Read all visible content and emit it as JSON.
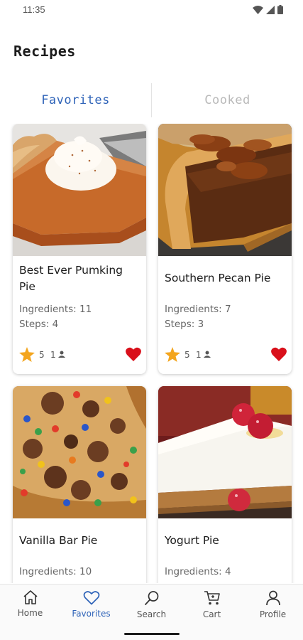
{
  "status_bar": {
    "time": "11:35",
    "icons": [
      "wifi-icon",
      "signal-icon",
      "battery-icon"
    ]
  },
  "page": {
    "title": "Recipes"
  },
  "tabs": [
    {
      "label": "Favorites",
      "active": true
    },
    {
      "label": "Cooked",
      "active": false
    }
  ],
  "recipes": [
    {
      "title": "Best Ever Pumking Pie",
      "ingredients": "Ingredients: 11",
      "steps": "Steps: 4",
      "rating": "5",
      "cooks": "1",
      "favorite": true,
      "image": "pumpkin-pie-photo"
    },
    {
      "title": "Southern Pecan Pie",
      "ingredients": "Ingredients: 7",
      "steps": "Steps: 3",
      "rating": "5",
      "cooks": "1",
      "favorite": true,
      "image": "pecan-pie-photo"
    },
    {
      "title": "Vanilla Bar Pie",
      "ingredients": "Ingredients: 10",
      "steps": "",
      "rating": "",
      "cooks": "",
      "favorite": true,
      "image": "cookie-pie-photo"
    },
    {
      "title": "Yogurt Pie",
      "ingredients": "Ingredients: 4",
      "steps": "",
      "rating": "",
      "cooks": "",
      "favorite": true,
      "image": "yogurt-pie-photo"
    }
  ],
  "bottom_nav": [
    {
      "label": "Home",
      "icon": "home-icon",
      "active": false
    },
    {
      "label": "Favorites",
      "icon": "heart-icon",
      "active": true
    },
    {
      "label": "Search",
      "icon": "search-icon",
      "active": false
    },
    {
      "label": "Cart",
      "icon": "cart-icon",
      "active": false
    },
    {
      "label": "Profile",
      "icon": "profile-icon",
      "active": false
    }
  ],
  "colors": {
    "accent": "#2e63b8",
    "favorite": "#d9101b",
    "star": "#f3a51e",
    "inactive_tab": "#b9b9b9"
  }
}
